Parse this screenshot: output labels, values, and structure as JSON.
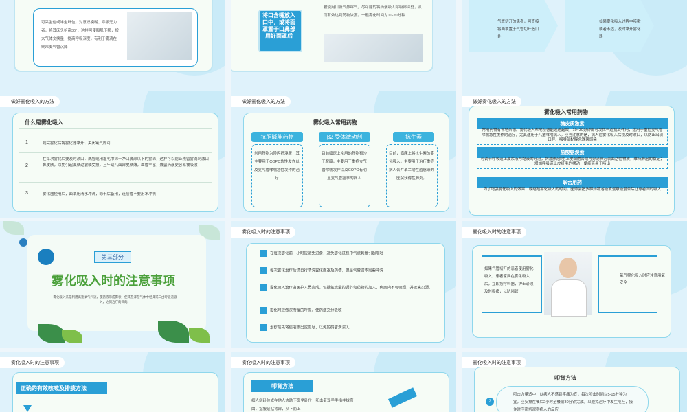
{
  "slides": {
    "s1": {
      "text": "可采坐位或半坐卧位，对意识模糊、呼吸无力者，将其床头抬高30°，这样可使膈肌下移，增大气体交换量，提高呼吸深度，有利于雾滴在终末支气管沉降"
    },
    "s2": {
      "callout": "将口含嘴放入口中，或将面罩置于口鼻部用好面罩后",
      "text": "被使用口吸气鼻呼气，尽可能的将药液吸入呼吸部深处，从而有效达到药物浓度。一般雾化时间为10-20分钟"
    },
    "s3": {
      "left": "气管切开的患者，可直接将面罩置于气管切开造口处",
      "right": "如果雾化吸入过程中咳嗽或者不适，及时拿开雾化器"
    },
    "s4": {
      "crumb": "做好雾化吸入的方法",
      "title": "什么是雾化吸入",
      "items": [
        {
          "num": "1",
          "text": "病完雾化后将雾化器拿开，关闭氧气即可"
        },
        {
          "num": "2",
          "text": "在每次雾化后要及时漱口，洗脸或用湿毛巾抹干净口鼻部以下的雾珠，这样可以防止残留雾滴刺激口鼻皮肤，以免引起皮肤过敏或受损，且年幼儿面部皮肤薄，血管丰富，残留药液更容易被吸收"
        },
        {
          "num": "3",
          "text": "雾化器使用后，面罩用清水冲洗，晾干后备用，连接管不要用水冲洗"
        }
      ]
    },
    "s5": {
      "crumb": "做好雾化吸入的方法",
      "title": "雾化吸入常用药物",
      "pills": [
        "抗胆碱能药物",
        "β2 受体激动剂",
        "抗生素"
      ],
      "cols": [
        "常用药物为异丙托溴胺，其主要用于COPD急性发作以及支气管哮喘急性发作的治疗",
        "目前临床上常用的药物有沙丁胺醇，主要用于重症支气管哮喘发作以及COPD有明显支气管痉挛的病人",
        "目前，临床上将抗生素的雾化吸入，主要用于治疗重症病人合并革兰阴性菌感染的医院获得性肺炎。"
      ]
    },
    "s6": {
      "crumb": "做好雾化吸入的方法",
      "title": "雾化吸入常用药物",
      "sections": [
        {
          "head": "糖皮质激素",
          "text": "常用药物有布地奈德。雾化吸入布地奈德能迅速起效，10~30分钟即可发挥气道抗炎作用，适用于重症支气管哮喘急性发作的治疗，尤其适用于儿童哮喘病人。应当注意的是，病人在雾化吸入后须及时漱口，以防止出现口腔、咽喉部黏膜念珠菌感染"
        },
        {
          "head": "盐酸氨溴索",
          "text": "可调节呼吸道上皮浆液与黏液的分泌，刺激肺泡Ⅱ型上皮细胞合成与分泌肺泡表面活性物质，维持肺泡的稳定；增加呼吸道上皮纤毛的摆动，使痰液易于咳出"
        },
        {
          "head": "联合用药",
          "text": "为了增强雾化吸入的效果，或缩短雾化吸入的时间，医师会把多种药物溶液或混悬液混合后让患者同时吸入"
        }
      ]
    },
    "s7": {
      "badge": "第三部分",
      "title": "雾化吸入时的注意事项",
      "sub": "雾化吸入法是利用高速氧气气流，使药液形成雾状，使其悬浮在气体中经鼻或口由呼吸道吸入，达到治疗的目的。"
    },
    "s8": {
      "crumb": "雾化吸入时的注意事项",
      "items": [
        "在每次雾化前一小时应避免进食，避免雾化过程中气流刺激引起呕吐",
        "每次雾化治疗后请自行清洗雾化面罩及药槽，但是气管请不需要冲洗",
        "雾化吸入治疗由医护人员完成，包括氧流量的调节和药物的加入，病房内不可吸烟，并远离火源。",
        "雾化时应做深而慢的呼吸，使药液充分吸收",
        "治疗前先将痰液咳出或吸尽，以免妨碍雾滴深入"
      ]
    },
    "s9": {
      "crumb": "雾化吸入时的注意事项",
      "left": "如果气管切开的患者使用雾化吸入，患者家属在雾化吸入后，立即按呼叫器，护士必须及时吸痰，以防堵管",
      "right": "氧气雾化吸入时应注意用氧安全"
    },
    "s10": {
      "crumb": "雾化吸入时的注意事项",
      "banner": "正确的有效咳嗽及排痰方法"
    },
    "s11": {
      "crumb": "雾化吸入时的注意事项",
      "banner": "叩背方法",
      "text": "病人侧卧位或在他人协助下取坐卧位，叩击者双手手指并拢弯曲，指腹紧贴背部，从下而上"
    },
    "s12": {
      "crumb": "雾化吸入时的注意事项",
      "title": "叩背方法",
      "num": "2",
      "text": "叩击力量适中，以病人不感到疼痛为宜，每次叩击时间以5-15分钟为宜，应安排在餐后2小时至餐前30分钟完成，以避免治疗中发生呕吐，操作时应密切观察病人的反应"
    }
  }
}
